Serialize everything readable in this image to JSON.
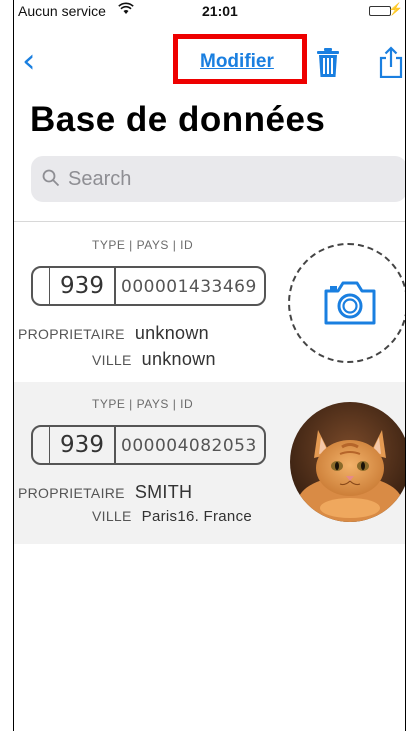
{
  "status": {
    "carrier": "Aucun service",
    "time": "21:01",
    "wifi_icon": "wifi-icon",
    "battery_color": "#35c759"
  },
  "nav": {
    "back_icon": "chevron-left-icon",
    "edit_label": "Modifier",
    "trash_icon": "trash-icon",
    "share_icon": "share-icon",
    "accent": "#1a7fe0",
    "highlight_color": "#ee0000"
  },
  "title": "Base de données",
  "search": {
    "placeholder": "Search"
  },
  "records": [
    {
      "header": "TYPE | PAYS | ID",
      "code": "939",
      "number": "000001433469",
      "owner_label": "PROPRIETAIRE",
      "owner": "unknown",
      "city_label": "VILLE",
      "city": "unknown",
      "photo": "camera-placeholder"
    },
    {
      "header": "TYPE | PAYS | ID",
      "code": "939",
      "number": "000004082053",
      "owner_label": "PROPRIETAIRE",
      "owner": "SMITH",
      "city_label": "VILLE",
      "city": "Paris16. France",
      "photo": "cat-photo"
    }
  ]
}
